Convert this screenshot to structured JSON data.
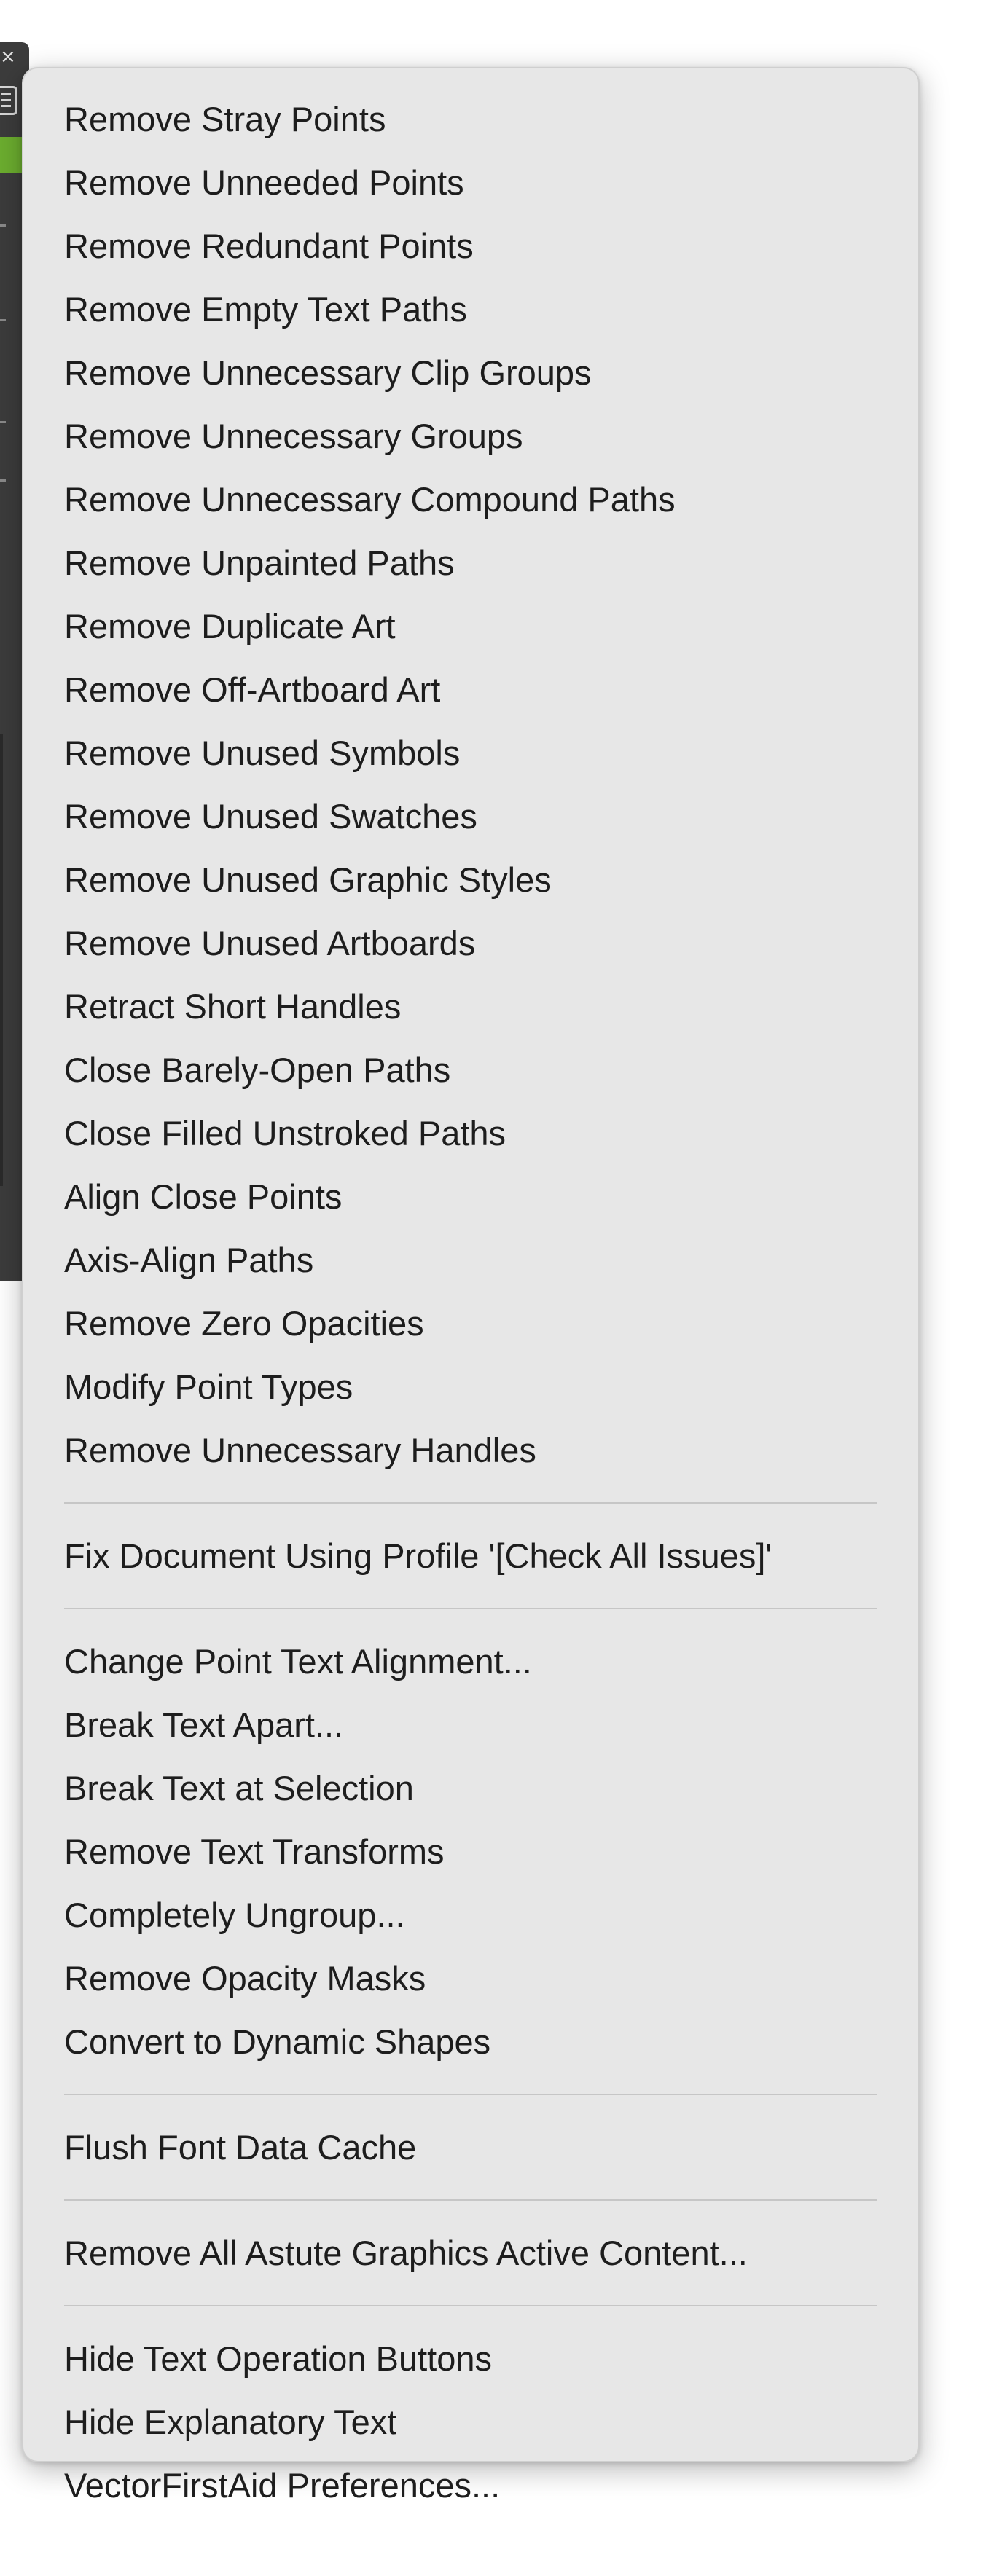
{
  "menu": {
    "group1": [
      "Remove Stray Points",
      "Remove Unneeded Points",
      "Remove Redundant Points",
      "Remove Empty Text Paths",
      "Remove Unnecessary Clip Groups",
      "Remove Unnecessary Groups",
      "Remove Unnecessary Compound Paths",
      "Remove Unpainted Paths",
      "Remove Duplicate Art",
      "Remove Off-Artboard Art",
      "Remove Unused Symbols",
      "Remove Unused Swatches",
      "Remove Unused Graphic Styles",
      "Remove Unused Artboards",
      "Retract Short Handles",
      "Close Barely-Open Paths",
      "Close Filled Unstroked Paths",
      "Align Close Points",
      "Axis-Align Paths",
      "Remove Zero Opacities",
      "Modify Point Types",
      "Remove Unnecessary Handles"
    ],
    "group2": [
      "Fix Document Using Profile '[Check All Issues]'"
    ],
    "group3": [
      "Change Point Text Alignment...",
      "Break Text Apart...",
      "Break Text at Selection",
      "Remove Text Transforms",
      "Completely Ungroup...",
      "Remove Opacity Masks",
      "Convert to Dynamic Shapes"
    ],
    "group4": [
      "Flush Font Data Cache"
    ],
    "group5": [
      "Remove All Astute Graphics Active Content..."
    ],
    "group6": [
      "Hide Text Operation Buttons",
      "Hide Explanatory Text",
      "VectorFirstAid Preferences..."
    ]
  },
  "colors": {
    "menu_background": "#e7e7e7",
    "menu_text": "#1d1d1d",
    "separator": "#c6c6c6",
    "panel_background": "#3c3c3c",
    "panel_accent": "#6cae2f"
  },
  "icons": {
    "panel_close": "close-icon",
    "panel_menu": "hamburger-menu-icon"
  }
}
